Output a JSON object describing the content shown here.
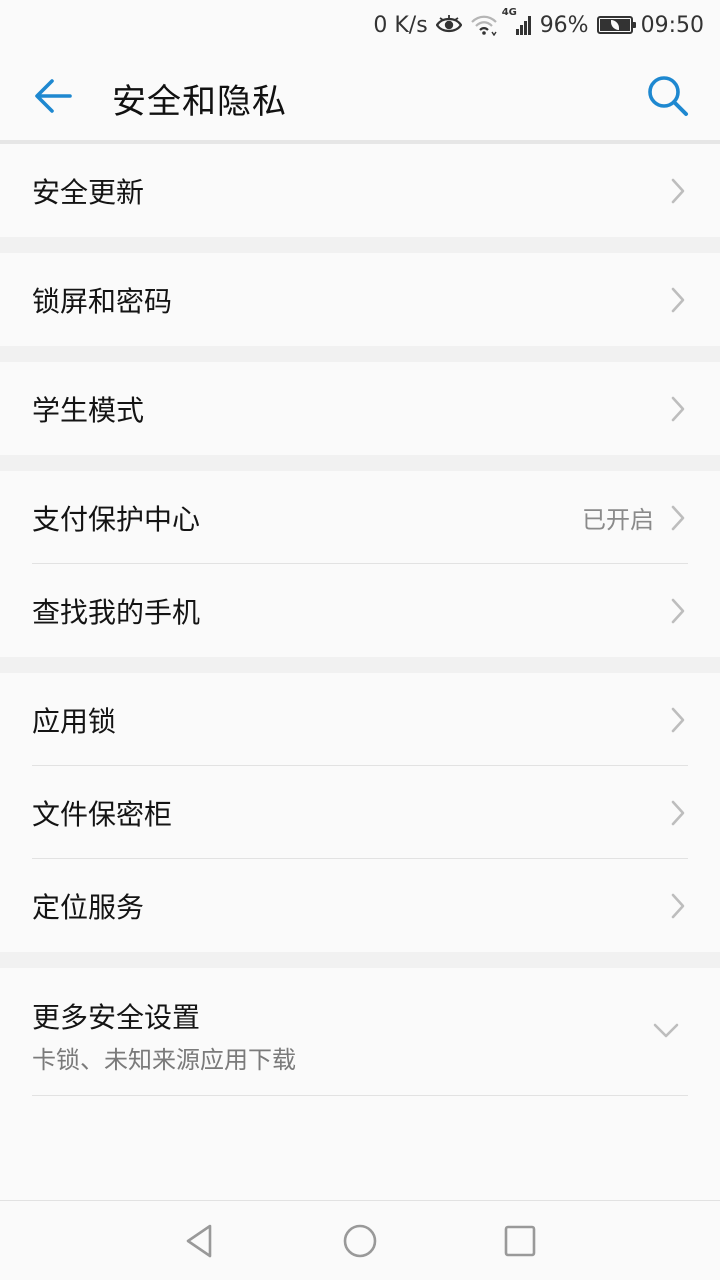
{
  "status": {
    "speed": "0 K/s",
    "network": "4G",
    "battery": "96%",
    "battery_level": 0.96,
    "time": "09:50"
  },
  "appbar": {
    "title": "安全和隐私",
    "back_icon": "arrow-left-icon",
    "search_icon": "search-icon"
  },
  "colors": {
    "accent": "#1e88d0",
    "background": "#fafafa",
    "gap": "#f1f1f1",
    "divider": "#e2e2e2",
    "secondary_text": "#8a8a8a"
  },
  "groups": [
    {
      "items": [
        {
          "label": "安全更新"
        }
      ]
    },
    {
      "items": [
        {
          "label": "锁屏和密码"
        }
      ]
    },
    {
      "items": [
        {
          "label": "学生模式"
        }
      ]
    },
    {
      "items": [
        {
          "label": "支付保护中心",
          "value": "已开启"
        },
        {
          "label": "查找我的手机"
        }
      ]
    },
    {
      "items": [
        {
          "label": "应用锁"
        },
        {
          "label": "文件保密柜"
        },
        {
          "label": "定位服务"
        }
      ]
    },
    {
      "items": [
        {
          "label": "更多安全设置",
          "sub": "卡锁、未知来源应用下载",
          "expand_icon": "chevron-down-icon"
        }
      ]
    }
  ],
  "navbar": {
    "back": "triangle-back-icon",
    "home": "circle-home-icon",
    "recents": "square-recents-icon"
  }
}
